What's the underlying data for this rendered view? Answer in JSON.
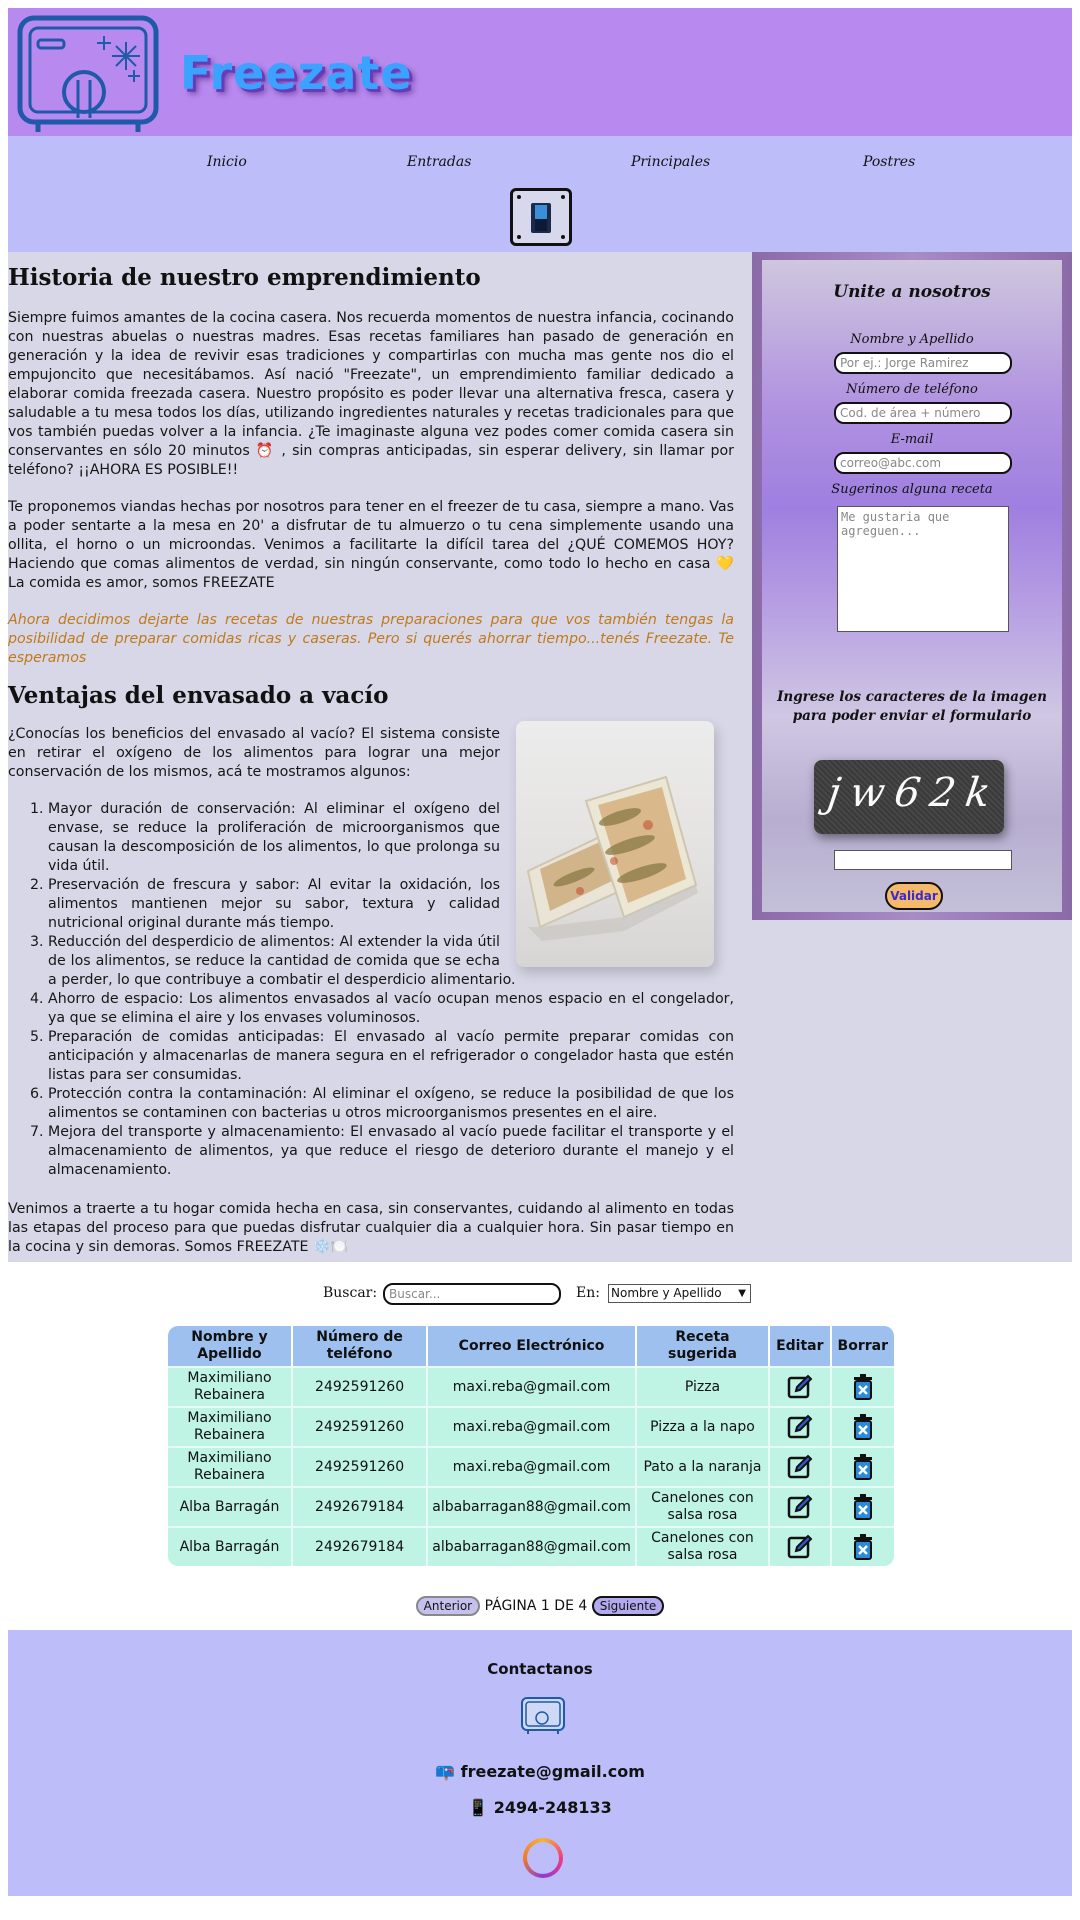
{
  "brand": {
    "name": "Freezate"
  },
  "nav": {
    "items": [
      "Inicio",
      "Entradas",
      "Principales",
      "Postres"
    ]
  },
  "article": {
    "history_title": "Historia de nuestro emprendimiento",
    "p1": "Siempre fuimos amantes de la cocina casera. Nos recuerda momentos de nuestra infancia, cocinando con nuestras abuelas o nuestras madres. Esas recetas familiares han pasado de generación en generación y la idea de revivir esas tradiciones y compartirlas con mucha mas gente nos dio el empujoncito que necesitábamos. Así nació \"Freezate\", un emprendimiento familiar dedicado a elaborar comida freezada casera. Nuestro propósito es poder llevar una alternativa fresca, casera y saludable a tu mesa todos los días, utilizando ingredientes naturales y recetas tradicionales para que vos también puedas volver a la infancia. ¿Te imaginaste alguna vez podes comer comida casera sin conservantes en sólo 20 minutos ⏰ , sin compras anticipadas, sin esperar delivery, sin llamar por teléfono? ¡¡AHORA ES POSIBLE!!",
    "p2": "Te proponemos viandas hechas por nosotros para tener en el freezer de tu casa, siempre a mano. Vas a poder sentarte a la mesa en 20' a disfrutar de tu almuerzo o tu cena simplemente usando una ollita, el horno o un microondas. Venimos a facilitarte la difícil tarea del ¿QUÉ COMEMOS HOY? Haciendo que comas alimentos de verdad, sin ningún conservante, como todo lo hecho en casa 💛 La comida es amor, somos FREEZATE",
    "promo": "Ahora decidimos dejarte las recetas de nuestras preparaciones para que vos también tengas la posibilidad de preparar comidas ricas y caseras. Pero si querés ahorrar tiempo...tenés Freezate. Te esperamos",
    "vacuum_title": "Ventajas del envasado a vacío",
    "vacuum_intro": "¿Conocías los beneficios del envasado al vacío? El sistema consiste en retirar el oxígeno de los alimentos para lograr una mejor conservación de los mismos, acá te mostramos algunos:",
    "benefits": [
      "Mayor duración de conservación: Al eliminar el oxígeno del envase, se reduce la proliferación de microorganismos que causan la descomposición de los alimentos, lo que prolonga su vida útil.",
      "Preservación de frescura y sabor: Al evitar la oxidación, los alimentos mantienen mejor su sabor, textura y calidad nutricional original durante más tiempo.",
      "Reducción del desperdicio de alimentos: Al extender la vida útil de los alimentos, se reduce la cantidad de comida que se echa a perder, lo que contribuye a combatir el desperdicio alimentario.",
      "Ahorro de espacio: Los alimentos envasados al vacío ocupan menos espacio en el congelador, ya que se elimina el aire y los envases voluminosos.",
      "Preparación de comidas anticipadas: El envasado al vacío permite preparar comidas con anticipación y almacenarlas de manera segura en el refrigerador o congelador hasta que estén listas para ser consumidas.",
      "Protección contra la contaminación: Al eliminar el oxígeno, se reduce la posibilidad de que los alimentos se contaminen con bacterias u otros microorganismos presentes en el aire.",
      "Mejora del transporte y almacenamiento: El envasado al vacío puede facilitar el transporte y el almacenamiento de alimentos, ya que reduce el riesgo de deterioro durante el manejo y el almacenamiento."
    ],
    "closing": "Venimos a traerte a tu hogar comida hecha en casa, sin conservantes, cuidando al alimento en todas las etapas del proceso para que puedas disfrutar cualquier dia a cualquier hora. Sin pasar tiempo en la cocina y sin demoras. Somos FREEZATE ❄️🍽️"
  },
  "form": {
    "title": "Unite a nosotros",
    "name_label": "Nombre y Apellido",
    "name_placeholder": "Por ej.: Jorge Ramirez",
    "phone_label": "Número de teléfono",
    "phone_placeholder": "Cod. de área + número",
    "email_label": "E-mail",
    "email_placeholder": "correo@abc.com",
    "recipe_label": "Sugerinos alguna receta",
    "recipe_placeholder": "Me gustaria que agreguen...",
    "captcha_label": "Ingrese los caracteres de la imagen para poder enviar el formulario",
    "captcha_text": "jw62k",
    "submit": "Validar"
  },
  "search": {
    "label": "Buscar:",
    "placeholder": "Buscar...",
    "in_label": "En:",
    "selected": "Nombre y Apellido"
  },
  "table": {
    "headers": [
      "Nombre y Apellido",
      "Número de teléfono",
      "Correo Electrónico",
      "Receta sugerida",
      "Editar",
      "Borrar"
    ],
    "rows": [
      [
        "Maximiliano Rebainera",
        "2492591260",
        "maxi.reba@gmail.com",
        "Pizza"
      ],
      [
        "Maximiliano Rebainera",
        "2492591260",
        "maxi.reba@gmail.com",
        "Pizza a la napo"
      ],
      [
        "Maximiliano Rebainera",
        "2492591260",
        "maxi.reba@gmail.com",
        "Pato a la naranja"
      ],
      [
        "Alba Barragán",
        "2492679184",
        "albabarragan88@gmail.com",
        "Canelones con salsa rosa"
      ],
      [
        "Alba Barragán",
        "2492679184",
        "albabarragan88@gmail.com",
        "Canelones con salsa rosa"
      ]
    ]
  },
  "pagination": {
    "prev": "Anterior",
    "status": "PÁGINA 1 DE 4",
    "next": "Siguiente"
  },
  "footer": {
    "title": "Contactanos",
    "email": "freezate@gmail.com",
    "phone": "2494-248133"
  },
  "icons": {
    "logo": "freezer-plate-icon",
    "switch": "theme-switch-icon",
    "edit": "edit-pencil-icon",
    "delete": "trash-icon",
    "mailbox": "mailbox-icon",
    "phone": "mobile-phone-icon",
    "instagram": "instagram-icon"
  },
  "colors": {
    "header": "#b889ee",
    "nav": "#bdbdfa",
    "main": "#d8d7e7",
    "table_header": "#9ec0ef",
    "table_cell": "#bff4e5",
    "brand_text": "#3aa3ff",
    "promo_text": "#c07a1c"
  }
}
